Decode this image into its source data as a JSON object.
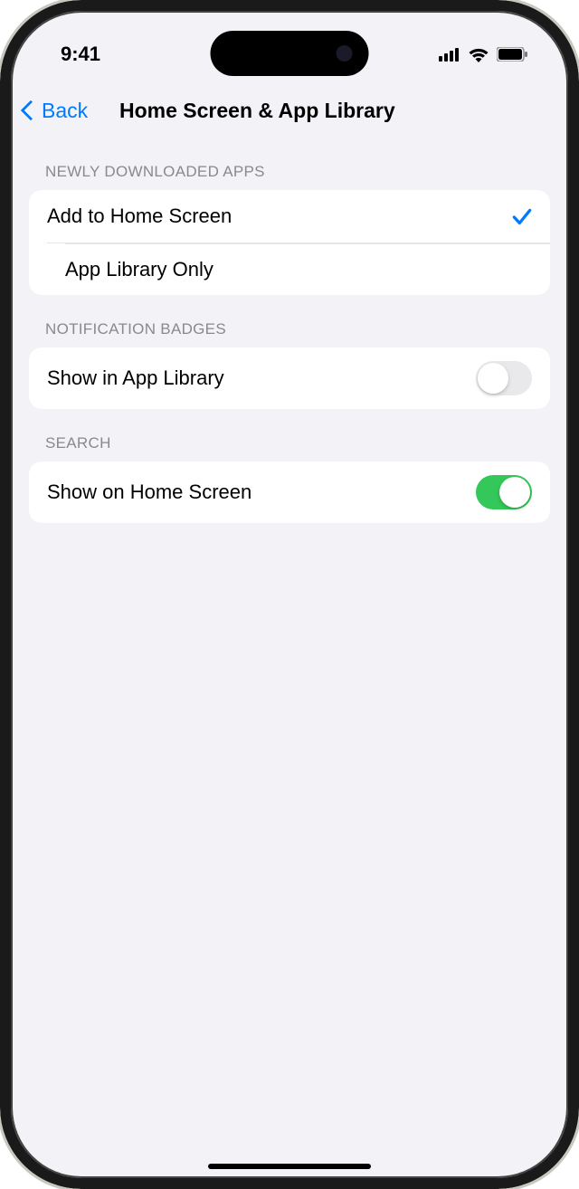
{
  "status": {
    "time": "9:41"
  },
  "nav": {
    "back_label": "Back",
    "title": "Home Screen & App Library"
  },
  "sections": {
    "newly_downloaded": {
      "header": "NEWLY DOWNLOADED APPS",
      "option_home": "Add to Home Screen",
      "option_library": "App Library Only",
      "selected": "home"
    },
    "notification_badges": {
      "header": "NOTIFICATION BADGES",
      "show_label": "Show in App Library",
      "enabled": false
    },
    "search": {
      "header": "SEARCH",
      "show_label": "Show on Home Screen",
      "enabled": true
    }
  }
}
